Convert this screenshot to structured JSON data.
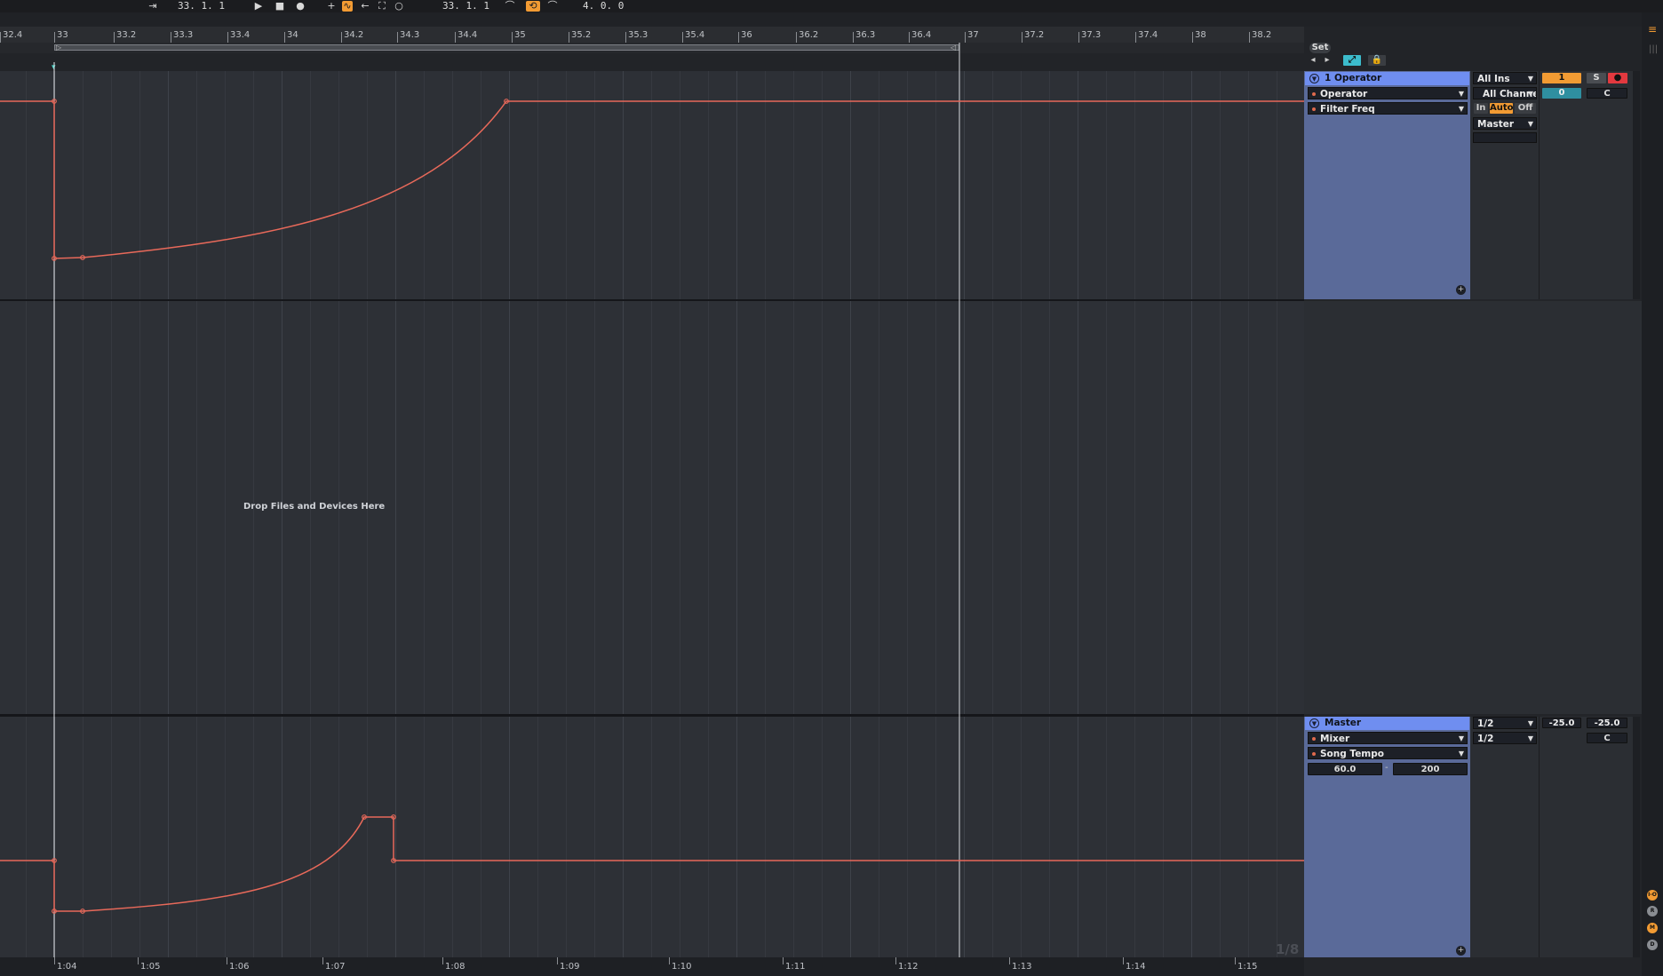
{
  "transport": {
    "arrangement_position": "33.   1.   1",
    "loop_start": "33.   1.   1",
    "loop_length": "4.   0.   0"
  },
  "ruler": {
    "bars": [
      "32.4",
      "33",
      "33.2",
      "33.3",
      "33.4",
      "34",
      "34.2",
      "34.3",
      "34.4",
      "35",
      "35.2",
      "35.3",
      "35.4",
      "36",
      "36.2",
      "36.3",
      "36.4",
      "37",
      "37.2",
      "37.3",
      "37.4",
      "38",
      "38.2"
    ]
  },
  "time_ruler": {
    "labels": [
      "1:04",
      "1:05",
      "1:06",
      "1:07",
      "1:08",
      "1:09",
      "1:10",
      "1:11",
      "1:12",
      "1:13",
      "1:14",
      "1:15"
    ]
  },
  "arrangement": {
    "drop_hint": "Drop Files and Devices Here",
    "grid_quantization": "1/8"
  },
  "header_controls": {
    "set_button": "Set"
  },
  "track1": {
    "name": "1 Operator",
    "device": "Operator",
    "parameter": "Filter Freq",
    "input_type": "All Ins",
    "input_channel": "All Channels",
    "monitor_in": "In",
    "monitor_auto": "Auto",
    "monitor_off": "Off",
    "output": "Master",
    "number": "1",
    "solo": "S",
    "arm": "●",
    "volume": "0",
    "pan": "C"
  },
  "master": {
    "name": "Master",
    "device": "Mixer",
    "parameter": "Song Tempo",
    "tempo_min": "60.0",
    "tempo_max": "200",
    "range_sep": "-",
    "audio_in": "1/2",
    "audio_out": "1/2",
    "volume_left": "-25.0",
    "volume_right": "-25.0",
    "pan": "C"
  },
  "side_indicators": [
    "I-O",
    "R",
    "M",
    "D"
  ],
  "colors": {
    "automation": "#e8695a",
    "track_header": "#6f8ef0",
    "panel_blue": "#5a6a99",
    "accent_orange": "#f29b33"
  }
}
